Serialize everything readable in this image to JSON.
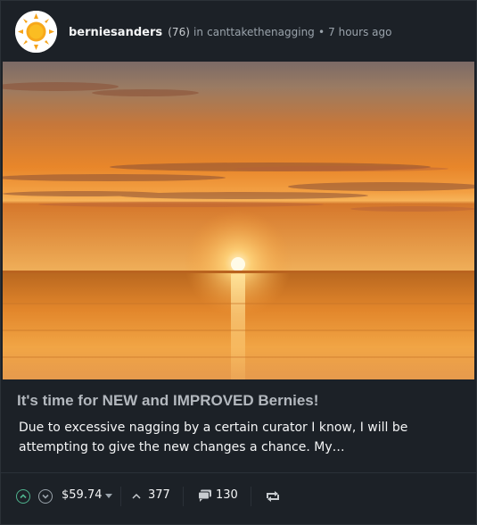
{
  "post": {
    "author": "berniesanders",
    "reputation": "(76)",
    "in_label": "in",
    "community": "canttakethenagging",
    "separator": "•",
    "time": "7 hours ago",
    "avatar_icon": "sun-avatar-icon",
    "title": "It's time for NEW and IMPROVED Bernies!",
    "body": "Due to excessive nagging by a certain curator I know, I will be attempting to give the new changes a chance. My…",
    "image_alt": "sunset over the sea"
  },
  "footer": {
    "payout": "$59.74",
    "votes": "377",
    "comments": "130",
    "icons": {
      "upvote": "chevron-up-circle-icon",
      "downvote": "chevron-down-circle-icon",
      "payout_menu": "caret-down-icon",
      "votes": "chevron-up-icon",
      "comments": "speech-bubble-icon",
      "reblog": "reblog-icon"
    }
  },
  "colors": {
    "background": "#1c2127",
    "border": "#2b3138",
    "upvote_accent": "#4fb38e",
    "title": "#b3b8be",
    "muted": "#9aa3ab"
  }
}
